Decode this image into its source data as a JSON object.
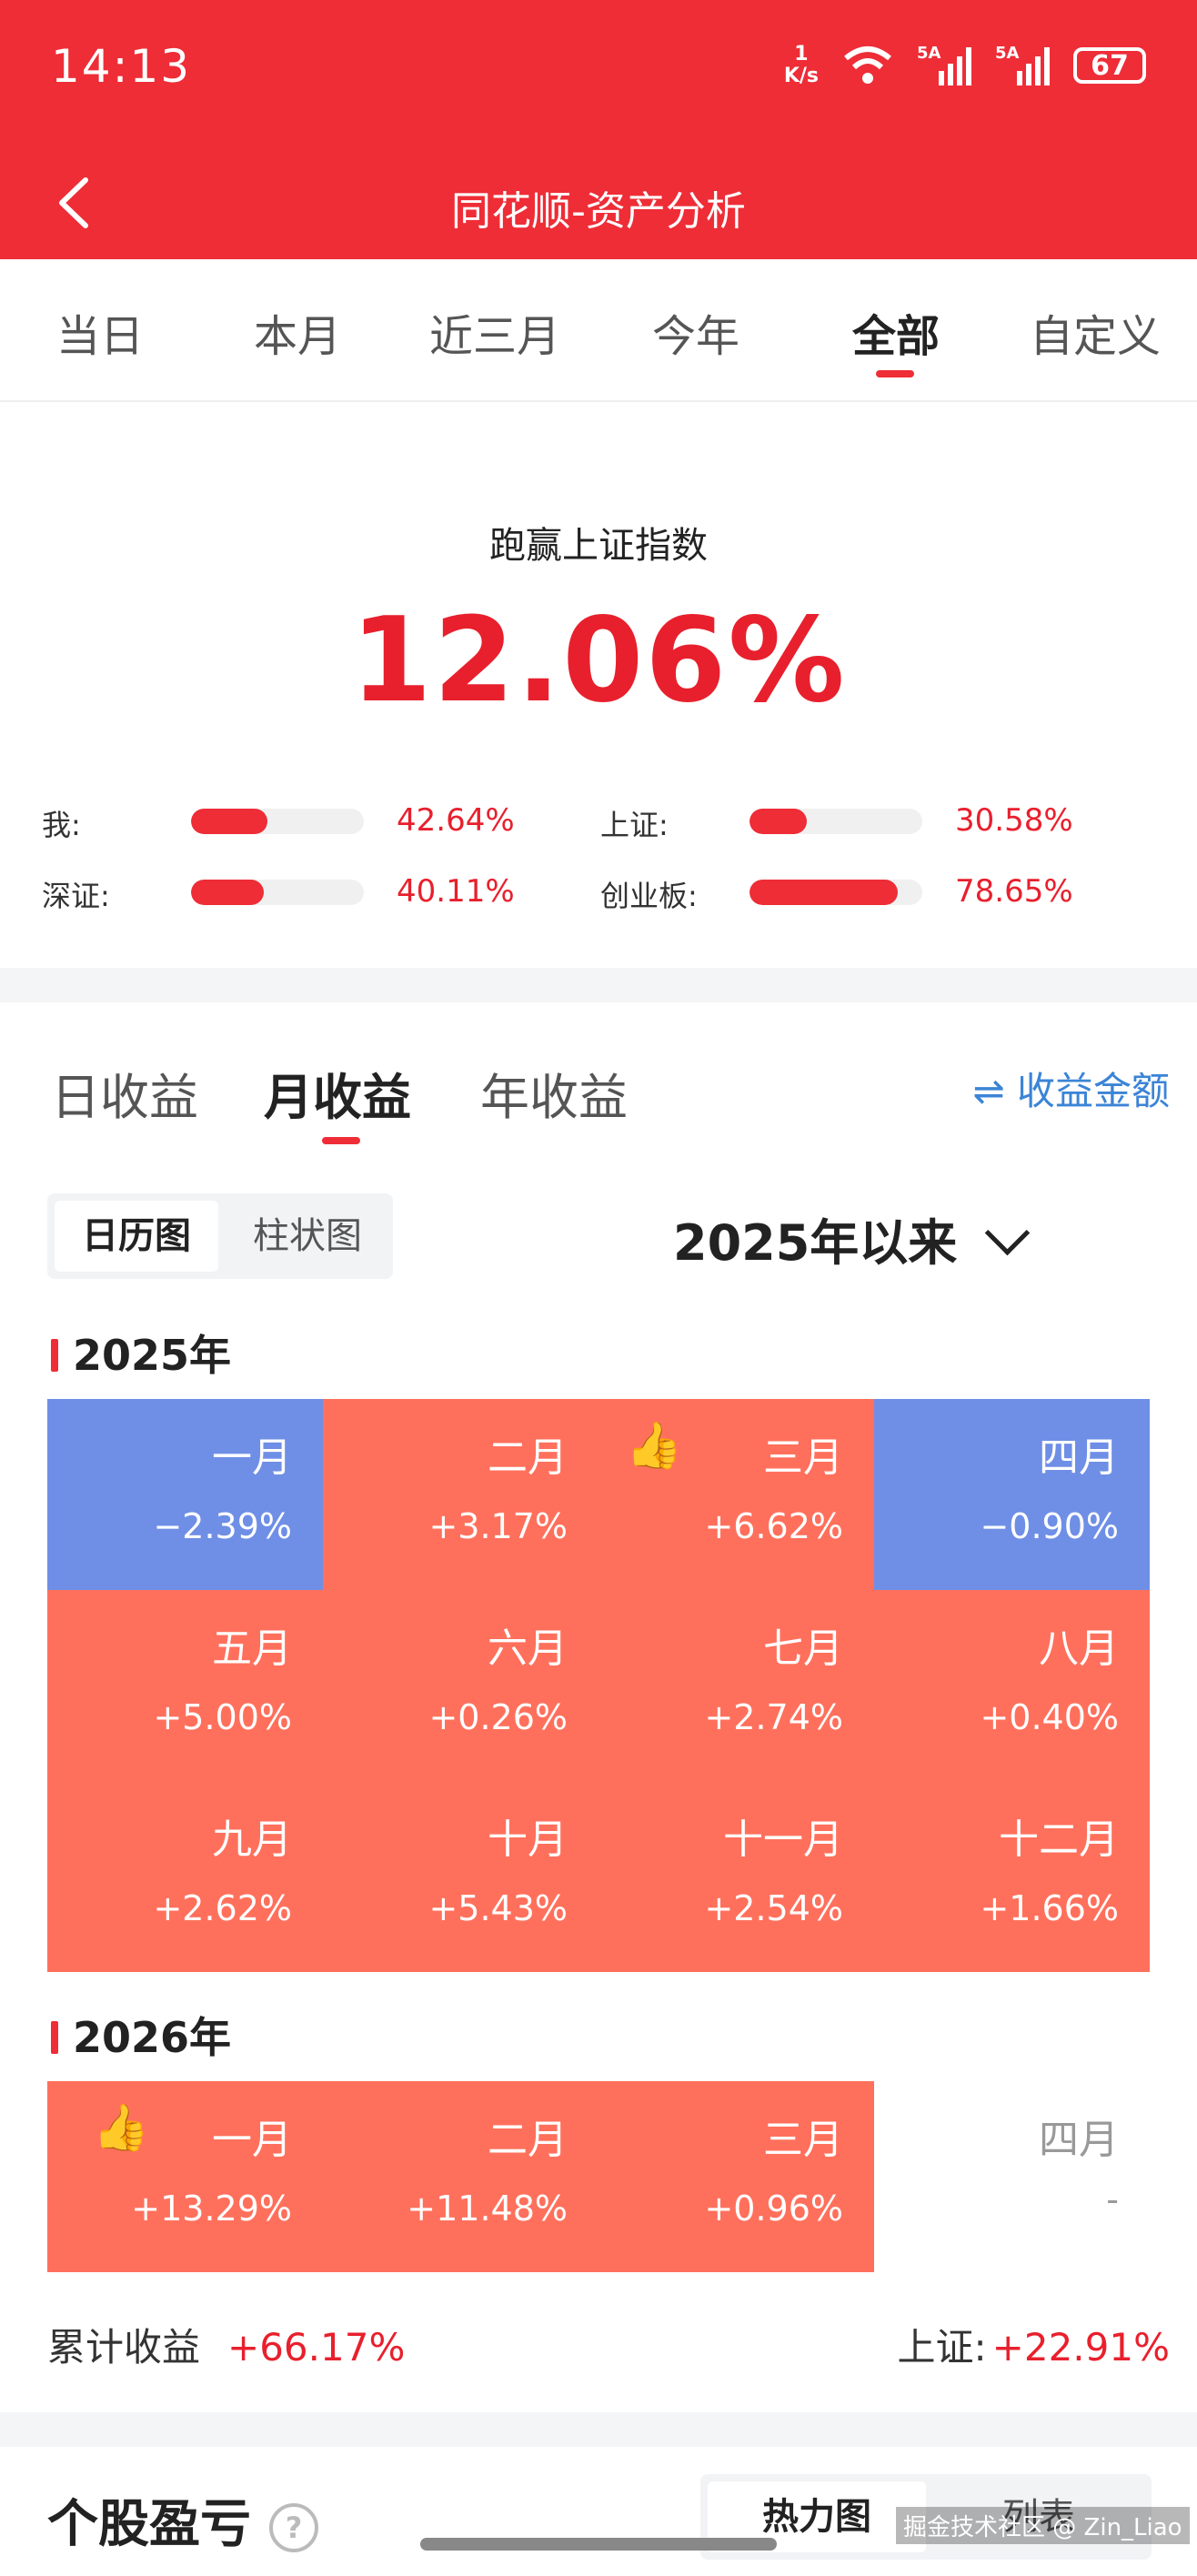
{
  "status": {
    "time": "14:13",
    "speed_value": "1",
    "speed_unit": "K/s",
    "battery": "67",
    "sig1": "5A",
    "sig2": "5A"
  },
  "nav": {
    "title": "同花顺-资产分析"
  },
  "period_tabs": [
    "当日",
    "本月",
    "近三月",
    "今年",
    "全部",
    "自定义"
  ],
  "summary": {
    "title": "跑赢上证指数",
    "value": "12.06%",
    "comparisons": [
      {
        "label": "我:",
        "value": "42.64%",
        "ratio": 0.4264
      },
      {
        "label": "上证:",
        "value": "30.58%",
        "ratio": 0.3058
      },
      {
        "label": "深证:",
        "value": "40.11%",
        "ratio": 0.4011
      },
      {
        "label": "创业板:",
        "value": "78.65%",
        "ratio": 0.7865
      }
    ]
  },
  "profit_tabs": [
    "日收益",
    "月收益",
    "年收益"
  ],
  "switch_label": "⇌ 收益金额",
  "view_tabs": [
    "日历图",
    "柱状图"
  ],
  "range_label": "2025年以来",
  "years": [
    {
      "year": "2025年",
      "months": [
        {
          "m": "一月",
          "v": "−2.39%",
          "sign": "neg"
        },
        {
          "m": "二月",
          "v": "+3.17%",
          "sign": "pos"
        },
        {
          "m": "三月",
          "v": "+6.62%",
          "sign": "pos",
          "best": true
        },
        {
          "m": "四月",
          "v": "−0.90%",
          "sign": "neg"
        },
        {
          "m": "五月",
          "v": "+5.00%",
          "sign": "pos"
        },
        {
          "m": "六月",
          "v": "+0.26%",
          "sign": "pos"
        },
        {
          "m": "七月",
          "v": "+2.74%",
          "sign": "pos"
        },
        {
          "m": "八月",
          "v": "+0.40%",
          "sign": "pos"
        },
        {
          "m": "九月",
          "v": "+2.62%",
          "sign": "pos"
        },
        {
          "m": "十月",
          "v": "+5.43%",
          "sign": "pos"
        },
        {
          "m": "十一月",
          "v": "+2.54%",
          "sign": "pos"
        },
        {
          "m": "十二月",
          "v": "+1.66%",
          "sign": "pos"
        }
      ]
    },
    {
      "year": "2026年",
      "months": [
        {
          "m": "一月",
          "v": "+13.29%",
          "sign": "pos",
          "best": true
        },
        {
          "m": "二月",
          "v": "+11.48%",
          "sign": "pos"
        },
        {
          "m": "三月",
          "v": "+0.96%",
          "sign": "pos"
        },
        {
          "m": "四月",
          "v": "-",
          "sign": "empty"
        }
      ]
    }
  ],
  "totals": {
    "label": "累计收益",
    "value": "+66.17%",
    "sh_label": "上证:",
    "sh_value": "+22.91%"
  },
  "stock_section": {
    "title": "个股盈亏",
    "help": "?",
    "tabs": [
      "热力图",
      "列表"
    ]
  },
  "watermark": "掘金技术社区 @ Zin_Liao",
  "colors": {
    "brand": "#ee2d37",
    "positive_cell": "#ff705c",
    "negative_cell": "#6f8fe6",
    "link": "#3b84d6"
  }
}
